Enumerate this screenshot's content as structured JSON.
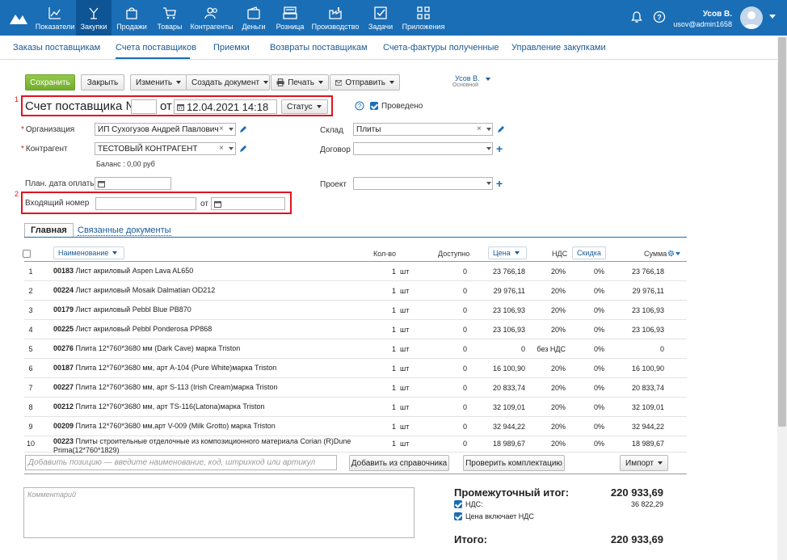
{
  "topnav": {
    "items": [
      {
        "label": "Показатели",
        "icon": "chart-icon"
      },
      {
        "label": "Закупки",
        "icon": "purchase-icon",
        "active": true
      },
      {
        "label": "Продажи",
        "icon": "bag-icon"
      },
      {
        "label": "Товары",
        "icon": "cart-icon"
      },
      {
        "label": "Контрагенты",
        "icon": "people-icon"
      },
      {
        "label": "Деньги",
        "icon": "wallet-icon"
      },
      {
        "label": "Розница",
        "icon": "register-icon"
      },
      {
        "label": "Производство",
        "icon": "factory-icon"
      },
      {
        "label": "Задачи",
        "icon": "check-icon"
      },
      {
        "label": "Приложения",
        "icon": "apps-icon"
      }
    ],
    "user_name": "Усов В.",
    "user_login": "usov@admin1658"
  },
  "subnav": {
    "items": [
      "Заказы поставщикам",
      "Счета поставщиков",
      "Приемки",
      "Возвраты поставщикам",
      "Счета-фактуры полученные",
      "Управление закупками"
    ]
  },
  "toolbar": {
    "save": "Сохранить",
    "close": "Закрыть",
    "edit": "Изменить",
    "create_doc": "Создать документ",
    "print": "Печать",
    "send": "Отправить",
    "owner": "Усов В.",
    "owner_group": "Основной"
  },
  "header": {
    "annotation_1": "1",
    "annotation_2": "2",
    "title": "Счет поставщика №",
    "number": "",
    "from": "от",
    "date": "12.04.2021 14:18",
    "status": "Статус",
    "conducted": "Проведено"
  },
  "form": {
    "org_label": "Организация",
    "org_value": "ИП Сухогузов Андрей Павлович",
    "contractor_label": "Контрагент",
    "contractor_value": "ТЕСТОВЫЙ КОНТРАГЕНТ",
    "balance": "Баланс : 0,00 руб",
    "pay_date_label": "План. дата оплаты",
    "warehouse_label": "Склад",
    "warehouse_value": "Плиты",
    "contract_label": "Договор",
    "project_label": "Проект",
    "incoming_label": "Входящий номер",
    "incoming_from": "от"
  },
  "tabs": [
    "Главная",
    "Связанные документы"
  ],
  "table": {
    "headers": {
      "name": "Наименование",
      "qty": "Кол-во",
      "available": "Доступно",
      "price": "Цена",
      "vat": "НДС",
      "discount": "Скидка",
      "sum": "Сумма"
    },
    "rows": [
      {
        "n": "1",
        "code": "00183",
        "name": " Лист акриловый Aspen Lava AL650",
        "qty": "1",
        "unit": "шт",
        "avail": "0",
        "price": "23 766,18",
        "vat": "20%",
        "disc": "0%",
        "sum": "23 766,18"
      },
      {
        "n": "2",
        "code": "00224",
        "name": " Лист акриловый Mosaik Dalmatian OD212",
        "qty": "1",
        "unit": "шт",
        "avail": "0",
        "price": "29 976,11",
        "vat": "20%",
        "disc": "0%",
        "sum": "29 976,11"
      },
      {
        "n": "3",
        "code": "00179",
        "name": " Лист акриловый Pebbl Blue PB870",
        "qty": "1",
        "unit": "шт",
        "avail": "0",
        "price": "23 106,93",
        "vat": "20%",
        "disc": "0%",
        "sum": "23 106,93"
      },
      {
        "n": "4",
        "code": "00225",
        "name": " Лист акриловый Pebbl Ponderosa PP868",
        "qty": "1",
        "unit": "шт",
        "avail": "0",
        "price": "23 106,93",
        "vat": "20%",
        "disc": "0%",
        "sum": "23 106,93"
      },
      {
        "n": "5",
        "code": "00276",
        "name": " Плита 12*760*3680 мм (Dark Cave) марка Triston",
        "qty": "1",
        "unit": "шт",
        "avail": "0",
        "price": "0",
        "vat": "без НДС",
        "disc": "0%",
        "sum": "0"
      },
      {
        "n": "6",
        "code": "00187",
        "name": " Плита 12*760*3680 мм, арт А-104 (Pure White)марка Triston",
        "qty": "1",
        "unit": "шт",
        "avail": "0",
        "price": "16 100,90",
        "vat": "20%",
        "disc": "0%",
        "sum": "16 100,90"
      },
      {
        "n": "7",
        "code": "00227",
        "name": " Плита 12*760*3680 мм, арт S-113 (Irish Cream)марка Triston",
        "qty": "1",
        "unit": "шт",
        "avail": "0",
        "price": "20 833,74",
        "vat": "20%",
        "disc": "0%",
        "sum": "20 833,74"
      },
      {
        "n": "8",
        "code": "00212",
        "name": " Плита 12*760*3680 мм, арт TS-116(Latona)марка Triston",
        "qty": "1",
        "unit": "шт",
        "avail": "0",
        "price": "32 109,01",
        "vat": "20%",
        "disc": "0%",
        "sum": "32 109,01"
      },
      {
        "n": "9",
        "code": "00209",
        "name": " Плита 12*760*3680 мм,арт V-009 (Milk Grotto) марка Triston",
        "qty": "1",
        "unit": "шт",
        "avail": "0",
        "price": "32 944,22",
        "vat": "20%",
        "disc": "0%",
        "sum": "32 944,22"
      },
      {
        "n": "10",
        "code": "00223",
        "name": " Плиты строительные отделочные из композиционного материала Corian (R)Dune Prima(12*760*1829)",
        "qty": "1",
        "unit": "шт",
        "avail": "0",
        "price": "18 989,67",
        "vat": "20%",
        "disc": "0%",
        "sum": "18 989,67"
      }
    ]
  },
  "footer_actions": {
    "add_placeholder": "Добавить позицию — введите наименование, код, штрихкод или артикул",
    "add_from_ref": "Добавить из справочника",
    "check_kit": "Проверить комплектацию",
    "import": "Импорт"
  },
  "totals": {
    "comment_placeholder": "Комментарий",
    "subtotal_label": "Промежуточный итог:",
    "subtotal_value": "220 933,69",
    "vat_label": "НДС:",
    "vat_value": "36 822,29",
    "price_incl_vat": "Цена включает НДС",
    "total_label": "Итого:",
    "total_value": "220 933,69"
  },
  "colors": {
    "topbar": "#1a6eb5",
    "active_nav": "#0e5595",
    "save_green": "#7cb342",
    "highlight_red": "#e0141e"
  }
}
